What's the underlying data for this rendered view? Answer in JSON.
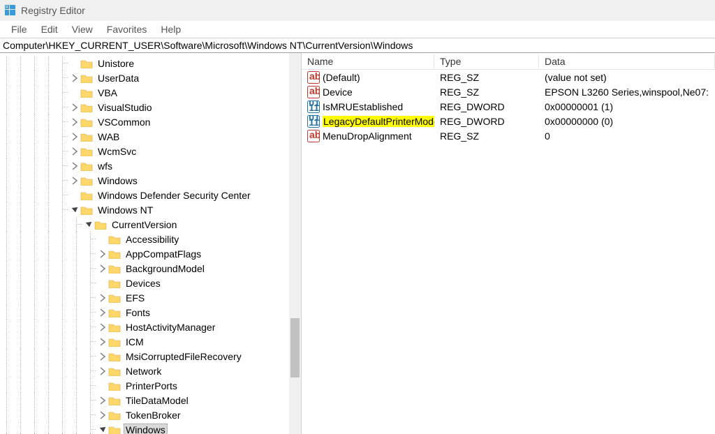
{
  "window": {
    "title": "Registry Editor"
  },
  "menu": {
    "file": "File",
    "edit": "Edit",
    "view": "View",
    "favorites": "Favorites",
    "help": "Help"
  },
  "path": "Computer\\HKEY_CURRENT_USER\\Software\\Microsoft\\Windows NT\\CurrentVersion\\Windows",
  "tree_items": [
    {
      "depth": 5,
      "chev": "none",
      "sel": false,
      "label": "Unistore"
    },
    {
      "depth": 5,
      "chev": "closed",
      "sel": false,
      "label": "UserData"
    },
    {
      "depth": 5,
      "chev": "none",
      "sel": false,
      "label": "VBA"
    },
    {
      "depth": 5,
      "chev": "closed",
      "sel": false,
      "label": "VisualStudio"
    },
    {
      "depth": 5,
      "chev": "closed",
      "sel": false,
      "label": "VSCommon"
    },
    {
      "depth": 5,
      "chev": "closed",
      "sel": false,
      "label": "WAB"
    },
    {
      "depth": 5,
      "chev": "closed",
      "sel": false,
      "label": "WcmSvc"
    },
    {
      "depth": 5,
      "chev": "closed",
      "sel": false,
      "label": "wfs"
    },
    {
      "depth": 5,
      "chev": "closed",
      "sel": false,
      "label": "Windows"
    },
    {
      "depth": 5,
      "chev": "none",
      "sel": false,
      "label": "Windows Defender Security Center"
    },
    {
      "depth": 5,
      "chev": "open",
      "sel": false,
      "label": "Windows NT"
    },
    {
      "depth": 6,
      "chev": "open",
      "sel": false,
      "label": "CurrentVersion"
    },
    {
      "depth": 7,
      "chev": "none",
      "sel": false,
      "label": "Accessibility"
    },
    {
      "depth": 7,
      "chev": "closed",
      "sel": false,
      "label": "AppCompatFlags"
    },
    {
      "depth": 7,
      "chev": "closed",
      "sel": false,
      "label": "BackgroundModel"
    },
    {
      "depth": 7,
      "chev": "none",
      "sel": false,
      "label": "Devices"
    },
    {
      "depth": 7,
      "chev": "closed",
      "sel": false,
      "label": "EFS"
    },
    {
      "depth": 7,
      "chev": "closed",
      "sel": false,
      "label": "Fonts"
    },
    {
      "depth": 7,
      "chev": "closed",
      "sel": false,
      "label": "HostActivityManager"
    },
    {
      "depth": 7,
      "chev": "closed",
      "sel": false,
      "label": "ICM"
    },
    {
      "depth": 7,
      "chev": "closed",
      "sel": false,
      "label": "MsiCorruptedFileRecovery"
    },
    {
      "depth": 7,
      "chev": "closed",
      "sel": false,
      "label": "Network"
    },
    {
      "depth": 7,
      "chev": "none",
      "sel": false,
      "label": "PrinterPorts"
    },
    {
      "depth": 7,
      "chev": "closed",
      "sel": false,
      "label": "TileDataModel"
    },
    {
      "depth": 7,
      "chev": "closed",
      "sel": false,
      "label": "TokenBroker"
    },
    {
      "depth": 7,
      "chev": "open",
      "sel": true,
      "label": "Windows"
    }
  ],
  "columns": {
    "name": "Name",
    "type": "Type",
    "data": "Data"
  },
  "values": [
    {
      "icon": "sz",
      "hl": false,
      "name": "(Default)",
      "type": "REG_SZ",
      "data": "(value not set)"
    },
    {
      "icon": "sz",
      "hl": false,
      "name": "Device",
      "type": "REG_SZ",
      "data": "EPSON L3260 Series,winspool,Ne07:"
    },
    {
      "icon": "dword",
      "hl": false,
      "name": "IsMRUEstablished",
      "type": "REG_DWORD",
      "data": "0x00000001 (1)"
    },
    {
      "icon": "dword",
      "hl": true,
      "name": "LegacyDefaultPrinterMode",
      "type": "REG_DWORD",
      "data": "0x00000000 (0)"
    },
    {
      "icon": "sz",
      "hl": false,
      "name": "MenuDropAlignment",
      "type": "REG_SZ",
      "data": "0"
    }
  ],
  "colors": {
    "highlight": "#ffff00",
    "selection": "#d9d9d9"
  }
}
